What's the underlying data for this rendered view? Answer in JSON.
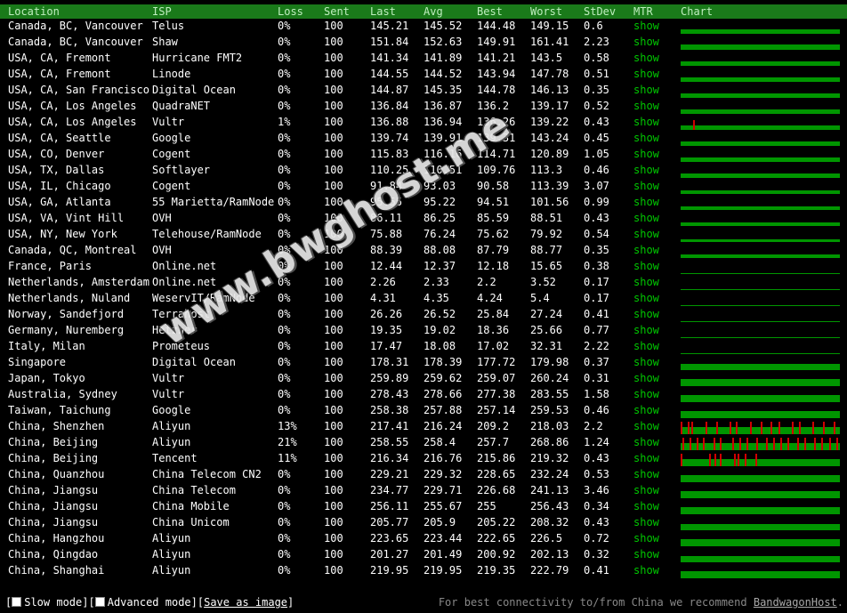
{
  "header": {
    "location": "Location",
    "isp": "ISP",
    "loss": "Loss",
    "sent": "Sent",
    "last": "Last",
    "avg": "Avg",
    "best": "Best",
    "worst": "Worst",
    "stdev": "StDev",
    "mtr": "MTR",
    "chart": "Chart"
  },
  "rows": [
    {
      "location": "Canada, BC, Vancouver",
      "isp": "Telus",
      "loss": "0%",
      "sent": "100",
      "last": "145.21",
      "avg": "145.52",
      "best": "144.48",
      "worst": "149.15",
      "stdev": "0.6",
      "mtr": "show",
      "bar": 0.5,
      "ticks": []
    },
    {
      "location": "Canada, BC, Vancouver",
      "isp": "Shaw",
      "loss": "0%",
      "sent": "100",
      "last": "151.84",
      "avg": "152.63",
      "best": "149.91",
      "worst": "161.41",
      "stdev": "2.23",
      "mtr": "show",
      "bar": 0.55,
      "ticks": []
    },
    {
      "location": "USA, CA, Fremont",
      "isp": "Hurricane FMT2",
      "loss": "0%",
      "sent": "100",
      "last": "141.34",
      "avg": "141.89",
      "best": "141.21",
      "worst": "143.5",
      "stdev": "0.58",
      "mtr": "show",
      "bar": 0.5,
      "ticks": []
    },
    {
      "location": "USA, CA, Fremont",
      "isp": "Linode",
      "loss": "0%",
      "sent": "100",
      "last": "144.55",
      "avg": "144.52",
      "best": "143.94",
      "worst": "147.78",
      "stdev": "0.51",
      "mtr": "show",
      "bar": 0.5,
      "ticks": []
    },
    {
      "location": "USA, CA, San Francisco",
      "isp": "Digital Ocean",
      "loss": "0%",
      "sent": "100",
      "last": "144.87",
      "avg": "145.35",
      "best": "144.78",
      "worst": "146.13",
      "stdev": "0.35",
      "mtr": "show",
      "bar": 0.5,
      "ticks": []
    },
    {
      "location": "USA, CA, Los Angeles",
      "isp": "QuadraNET",
      "loss": "0%",
      "sent": "100",
      "last": "136.84",
      "avg": "136.87",
      "best": "136.2",
      "worst": "139.17",
      "stdev": "0.52",
      "mtr": "show",
      "bar": 0.5,
      "ticks": []
    },
    {
      "location": "USA, CA, Los Angeles",
      "isp": "Vultr",
      "loss": "1%",
      "sent": "100",
      "last": "136.88",
      "avg": "136.94",
      "best": "136.26",
      "worst": "139.22",
      "stdev": "0.43",
      "mtr": "show",
      "bar": 0.5,
      "ticks": [
        14
      ]
    },
    {
      "location": "USA, CA, Seattle",
      "isp": "Google",
      "loss": "0%",
      "sent": "100",
      "last": "139.74",
      "avg": "139.91",
      "best": "139.31",
      "worst": "143.24",
      "stdev": "0.45",
      "mtr": "show",
      "bar": 0.5,
      "ticks": []
    },
    {
      "location": "USA, CO, Denver",
      "isp": "Cogent",
      "loss": "0%",
      "sent": "100",
      "last": "115.83",
      "avg": "116.16",
      "best": "114.71",
      "worst": "120.89",
      "stdev": "1.05",
      "mtr": "show",
      "bar": 0.45,
      "ticks": []
    },
    {
      "location": "USA, TX, Dallas",
      "isp": "Softlayer",
      "loss": "0%",
      "sent": "100",
      "last": "110.25",
      "avg": "110.51",
      "best": "109.76",
      "worst": "113.3",
      "stdev": "0.46",
      "mtr": "show",
      "bar": 0.45,
      "ticks": []
    },
    {
      "location": "USA, IL, Chicago",
      "isp": "Cogent",
      "loss": "0%",
      "sent": "100",
      "last": "91.84",
      "avg": "93.03",
      "best": "90.58",
      "worst": "113.39",
      "stdev": "3.07",
      "mtr": "show",
      "bar": 0.4,
      "ticks": []
    },
    {
      "location": "USA, GA, Atlanta",
      "isp": "55 Marietta/RamNode",
      "loss": "0%",
      "sent": "100",
      "last": "95.55",
      "avg": "95.22",
      "best": "94.51",
      "worst": "101.56",
      "stdev": "0.99",
      "mtr": "show",
      "bar": 0.4,
      "ticks": []
    },
    {
      "location": "USA, VA, Vint Hill",
      "isp": "OVH",
      "loss": "0%",
      "sent": "100",
      "last": "86.11",
      "avg": "86.25",
      "best": "85.59",
      "worst": "88.51",
      "stdev": "0.43",
      "mtr": "show",
      "bar": 0.35,
      "ticks": []
    },
    {
      "location": "USA, NY, New York",
      "isp": "Telehouse/RamNode",
      "loss": "0%",
      "sent": "100",
      "last": "75.88",
      "avg": "76.24",
      "best": "75.62",
      "worst": "79.92",
      "stdev": "0.54",
      "mtr": "show",
      "bar": 0.3,
      "ticks": []
    },
    {
      "location": "Canada, QC, Montreal",
      "isp": "OVH",
      "loss": "0%",
      "sent": "100",
      "last": "88.39",
      "avg": "88.08",
      "best": "87.79",
      "worst": "88.77",
      "stdev": "0.35",
      "mtr": "show",
      "bar": 0.35,
      "ticks": []
    },
    {
      "location": "France, Paris",
      "isp": "Online.net",
      "loss": "0%",
      "sent": "100",
      "last": "12.44",
      "avg": "12.37",
      "best": "12.18",
      "worst": "15.65",
      "stdev": "0.38",
      "mtr": "show",
      "bar": 0.08,
      "ticks": []
    },
    {
      "location": "Netherlands, Amsterdam",
      "isp": "Online.net",
      "loss": "0%",
      "sent": "100",
      "last": "2.26",
      "avg": "2.33",
      "best": "2.2",
      "worst": "3.52",
      "stdev": "0.17",
      "mtr": "show",
      "bar": 0.04,
      "ticks": []
    },
    {
      "location": "Netherlands, Nuland",
      "isp": "WeservIT/RamNode",
      "loss": "0%",
      "sent": "100",
      "last": "4.31",
      "avg": "4.35",
      "best": "4.24",
      "worst": "5.4",
      "stdev": "0.17",
      "mtr": "show",
      "bar": 0.04,
      "ticks": []
    },
    {
      "location": "Norway, Sandefjord",
      "isp": "Terrahost",
      "loss": "0%",
      "sent": "100",
      "last": "26.26",
      "avg": "26.52",
      "best": "25.84",
      "worst": "27.24",
      "stdev": "0.41",
      "mtr": "show",
      "bar": 0.1,
      "ticks": []
    },
    {
      "location": "Germany, Nuremberg",
      "isp": "Hetzner",
      "loss": "0%",
      "sent": "100",
      "last": "19.35",
      "avg": "19.02",
      "best": "18.36",
      "worst": "25.66",
      "stdev": "0.77",
      "mtr": "show",
      "bar": 0.08,
      "ticks": []
    },
    {
      "location": "Italy, Milan",
      "isp": "Prometeus",
      "loss": "0%",
      "sent": "100",
      "last": "17.47",
      "avg": "18.08",
      "best": "17.02",
      "worst": "32.31",
      "stdev": "2.22",
      "mtr": "show",
      "bar": 0.08,
      "ticks": []
    },
    {
      "location": "Singapore",
      "isp": "Digital Ocean",
      "loss": "0%",
      "sent": "100",
      "last": "178.31",
      "avg": "178.39",
      "best": "177.72",
      "worst": "179.98",
      "stdev": "0.37",
      "mtr": "show",
      "bar": 0.65,
      "ticks": []
    },
    {
      "location": "Japan, Tokyo",
      "isp": "Vultr",
      "loss": "0%",
      "sent": "100",
      "last": "259.89",
      "avg": "259.62",
      "best": "259.07",
      "worst": "260.24",
      "stdev": "0.31",
      "mtr": "show",
      "bar": 0.8,
      "ticks": []
    },
    {
      "location": "Australia, Sydney",
      "isp": "Vultr",
      "loss": "0%",
      "sent": "100",
      "last": "278.43",
      "avg": "278.66",
      "best": "277.38",
      "worst": "283.55",
      "stdev": "1.58",
      "mtr": "show",
      "bar": 0.8,
      "ticks": []
    },
    {
      "location": "Taiwan, Taichung",
      "isp": "Google",
      "loss": "0%",
      "sent": "100",
      "last": "258.38",
      "avg": "257.88",
      "best": "257.14",
      "worst": "259.53",
      "stdev": "0.46",
      "mtr": "show",
      "bar": 0.8,
      "ticks": []
    },
    {
      "location": "China, Shenzhen",
      "isp": "Aliyun",
      "loss": "13%",
      "sent": "100",
      "last": "217.41",
      "avg": "216.24",
      "best": "209.2",
      "worst": "218.03",
      "stdev": "2.2",
      "mtr": "show",
      "bar": 0.75,
      "ticks": [
        0,
        8,
        12,
        28,
        40,
        55,
        62,
        78,
        90,
        101,
        110,
        125,
        133,
        148,
        160,
        172
      ]
    },
    {
      "location": "China, Beijing",
      "isp": "Aliyun",
      "loss": "21%",
      "sent": "100",
      "last": "258.55",
      "avg": "258.4",
      "best": "257.7",
      "worst": "268.86",
      "stdev": "1.24",
      "mtr": "show",
      "bar": 0.8,
      "ticks": [
        2,
        10,
        18,
        25,
        37,
        44,
        58,
        66,
        74,
        85,
        96,
        104,
        112,
        120,
        131,
        139,
        150,
        158,
        167,
        175
      ]
    },
    {
      "location": "China, Beijing",
      "isp": "Tencent",
      "loss": "11%",
      "sent": "100",
      "last": "216.34",
      "avg": "216.76",
      "best": "215.86",
      "worst": "219.32",
      "stdev": "0.43",
      "mtr": "show",
      "bar": 0.75,
      "ticks": [
        0,
        32,
        38,
        44,
        60,
        64,
        72,
        84
      ]
    },
    {
      "location": "China, Quanzhou",
      "isp": "China Telecom CN2",
      "loss": "0%",
      "sent": "100",
      "last": "229.21",
      "avg": "229.32",
      "best": "228.65",
      "worst": "232.24",
      "stdev": "0.53",
      "mtr": "show",
      "bar": 0.75,
      "ticks": []
    },
    {
      "location": "China, Jiangsu",
      "isp": "China Telecom",
      "loss": "0%",
      "sent": "100",
      "last": "234.77",
      "avg": "229.71",
      "best": "226.68",
      "worst": "241.13",
      "stdev": "3.46",
      "mtr": "show",
      "bar": 0.75,
      "ticks": []
    },
    {
      "location": "China, Jiangsu",
      "isp": "China Mobile",
      "loss": "0%",
      "sent": "100",
      "last": "256.11",
      "avg": "255.67",
      "best": "255",
      "worst": "256.43",
      "stdev": "0.34",
      "mtr": "show",
      "bar": 0.8,
      "ticks": []
    },
    {
      "location": "China, Jiangsu",
      "isp": "China Unicom",
      "loss": "0%",
      "sent": "100",
      "last": "205.77",
      "avg": "205.9",
      "best": "205.22",
      "worst": "208.32",
      "stdev": "0.43",
      "mtr": "show",
      "bar": 0.7,
      "ticks": []
    },
    {
      "location": "China, Hangzhou",
      "isp": "Aliyun",
      "loss": "0%",
      "sent": "100",
      "last": "223.65",
      "avg": "223.44",
      "best": "222.65",
      "worst": "226.5",
      "stdev": "0.72",
      "mtr": "show",
      "bar": 0.75,
      "ticks": []
    },
    {
      "location": "China, Qingdao",
      "isp": "Aliyun",
      "loss": "0%",
      "sent": "100",
      "last": "201.27",
      "avg": "201.49",
      "best": "200.92",
      "worst": "202.13",
      "stdev": "0.32",
      "mtr": "show",
      "bar": 0.7,
      "ticks": []
    },
    {
      "location": "China, Shanghai",
      "isp": "Aliyun",
      "loss": "0%",
      "sent": "100",
      "last": "219.95",
      "avg": "219.95",
      "best": "219.35",
      "worst": "222.79",
      "stdev": "0.41",
      "mtr": "show",
      "bar": 0.75,
      "ticks": []
    }
  ],
  "footer": {
    "slow_mode": "Slow mode",
    "advanced_mode": "Advanced mode",
    "save_image": "Save as image",
    "recommend": "For best connectivity to/from China we recommend ",
    "recommend_link": "BandwagonHost",
    "recommend_end": "."
  },
  "watermark": "www.bwghost.me",
  "colors": {
    "header_bg": "#1a7a1a",
    "bar": "#009600",
    "loss_tick": "#d00000",
    "mtr_link": "#00c800"
  }
}
